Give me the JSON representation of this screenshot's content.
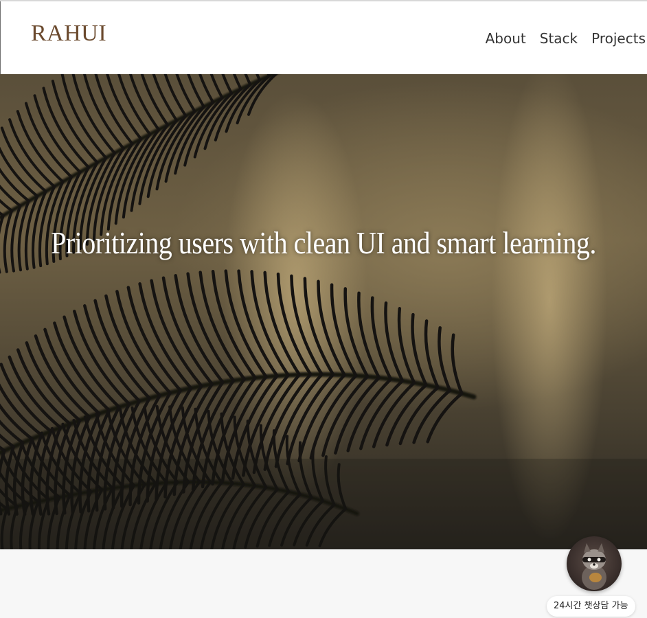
{
  "header": {
    "logo": "RAHUI",
    "nav": [
      "About",
      "Stack",
      "Projects"
    ]
  },
  "hero": {
    "headline": "Prioritizing users with clean UI and smart learning."
  },
  "chat": {
    "icon": "raccoon-avatar-icon",
    "label": "24시간 챗상담 가능"
  },
  "colors": {
    "logo": "#6b4a2e",
    "nav_text": "#333333",
    "hero_sand": "#8b7a56",
    "palm_shadow": "#151311"
  }
}
